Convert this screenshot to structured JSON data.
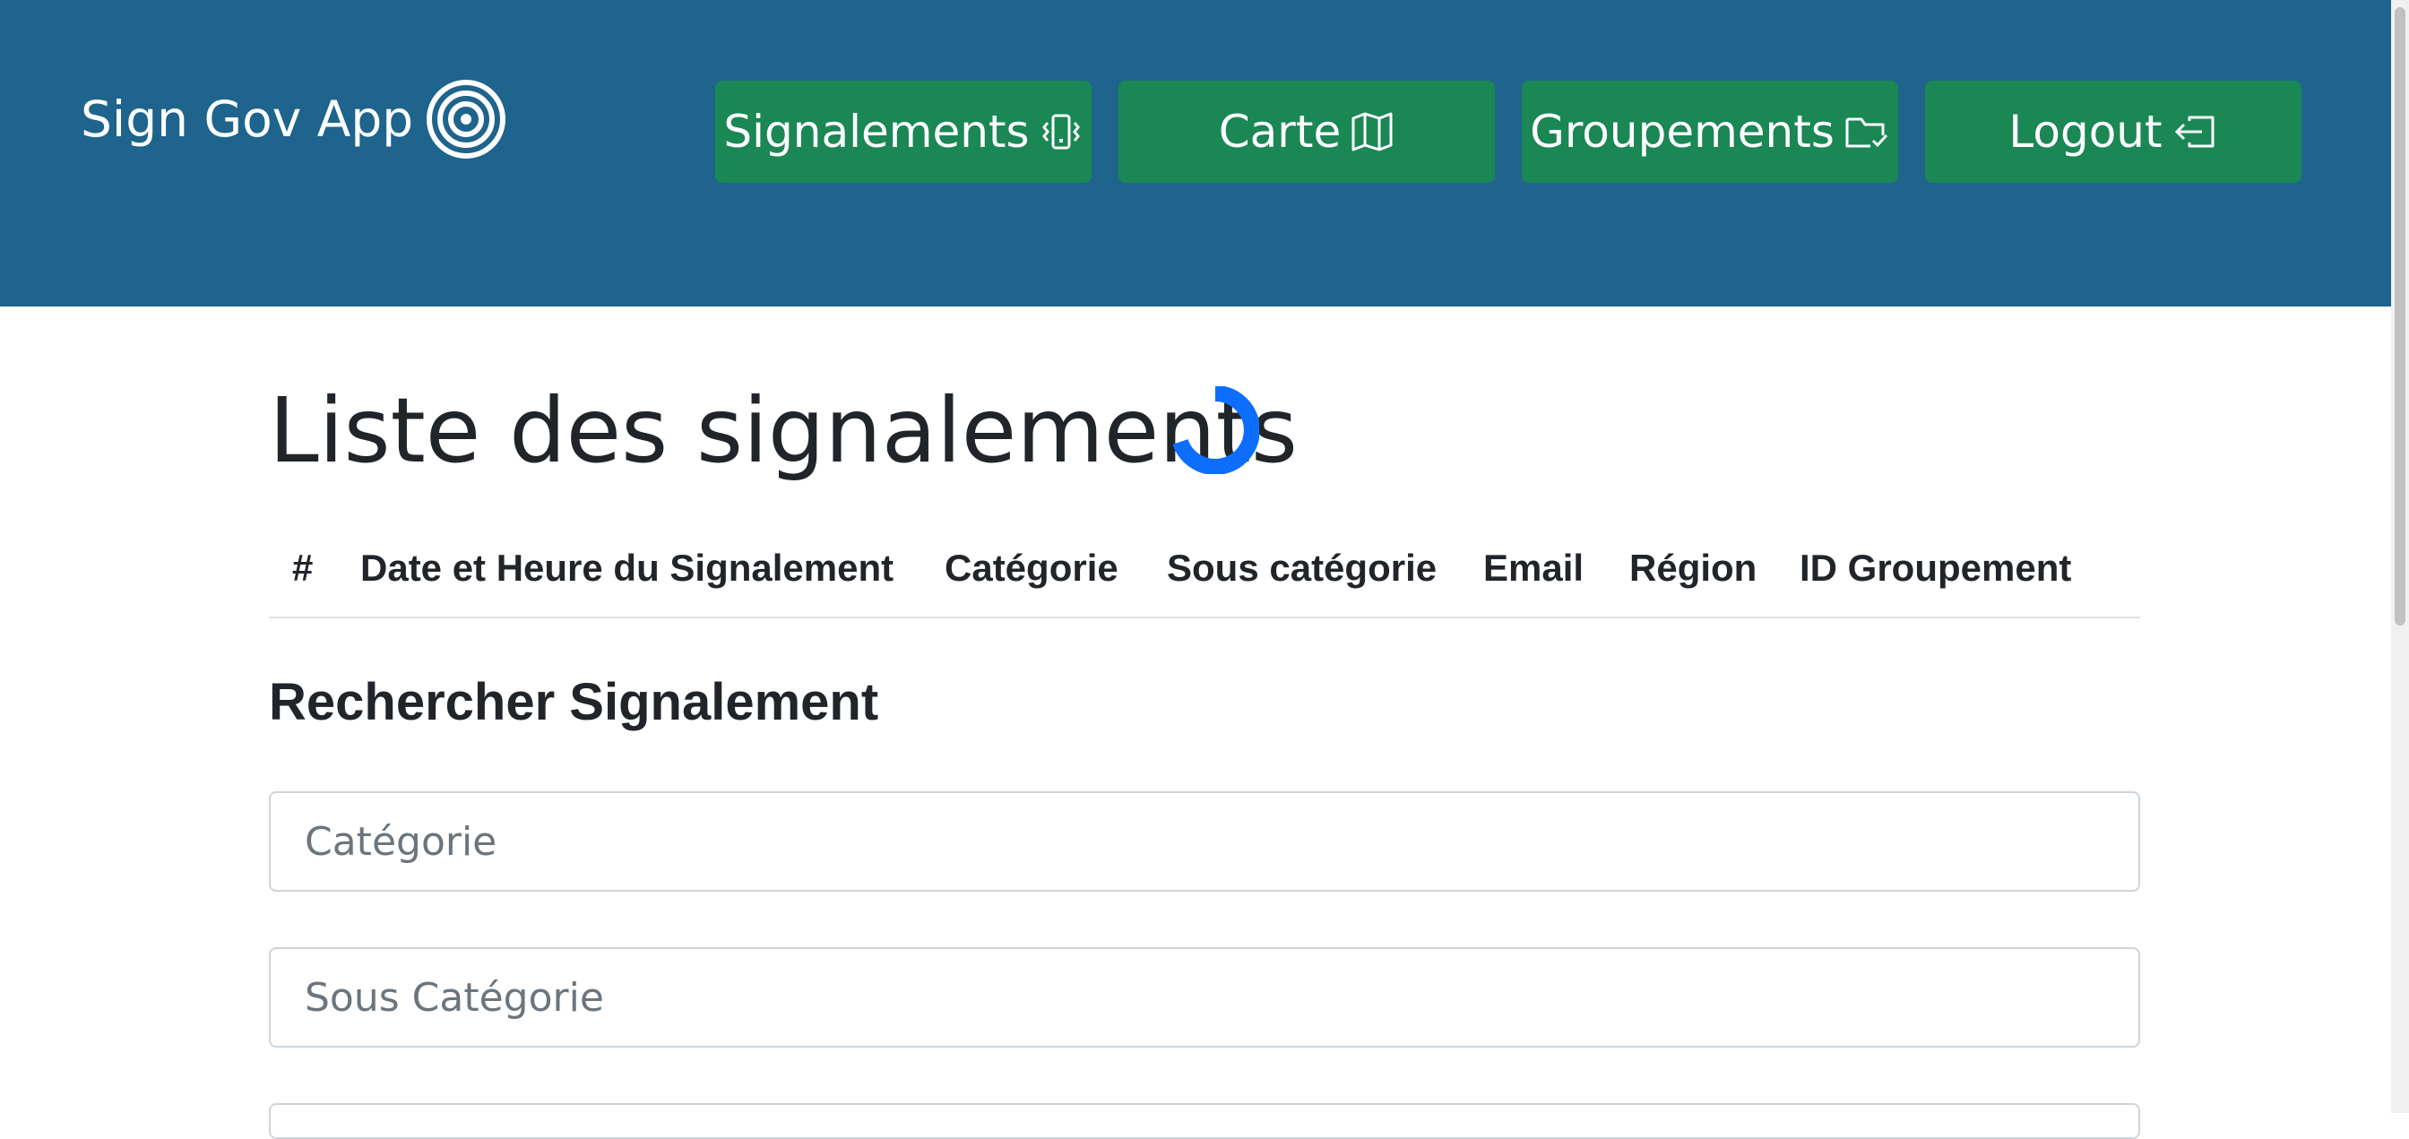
{
  "navbar": {
    "brand": "Sign Gov App",
    "buttons": [
      {
        "label": "Signalements",
        "icon": "phone-vibrate-icon"
      },
      {
        "label": "Carte",
        "icon": "map-icon"
      },
      {
        "label": "Groupements",
        "icon": "folder-check-icon"
      },
      {
        "label": "Logout",
        "icon": "box-arrow-left-icon"
      }
    ]
  },
  "main": {
    "title": "Liste des signalements",
    "table": {
      "columns": [
        "#",
        "Date et Heure du Signalement",
        "Catégorie",
        "Sous catégorie",
        "Email",
        "Région",
        "ID Groupement"
      ]
    },
    "search": {
      "heading": "Rechercher Signalement",
      "category_placeholder": "Catégorie",
      "subcategory_placeholder": "Sous Catégorie"
    }
  },
  "colors": {
    "navbar_bg": "#1e648c",
    "button_bg": "#1a8754",
    "spinner": "#0d6efd"
  }
}
